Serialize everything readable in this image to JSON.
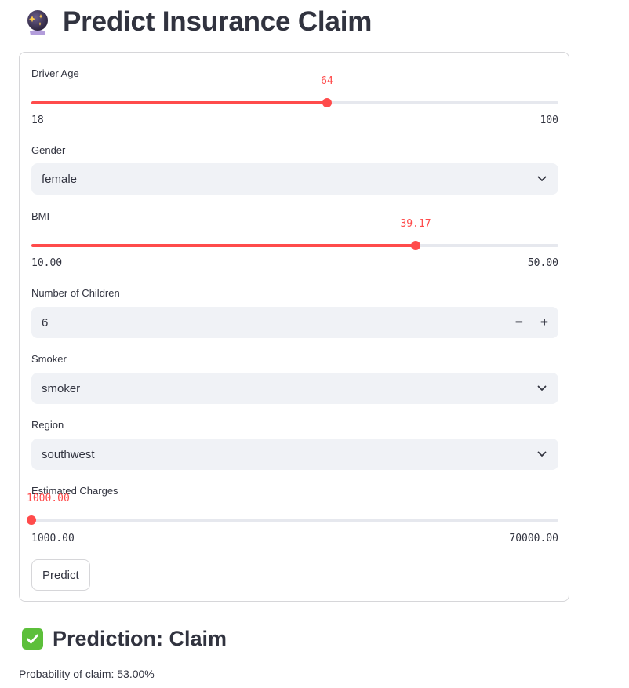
{
  "header": {
    "icon": "crystal-ball-icon",
    "title": "Predict Insurance Claim"
  },
  "form": {
    "driver_age": {
      "label": "Driver Age",
      "value": "64",
      "value_num": 64,
      "min": "18",
      "max": "100",
      "min_num": 18,
      "max_num": 100
    },
    "gender": {
      "label": "Gender",
      "value": "female"
    },
    "bmi": {
      "label": "BMI",
      "value": "39.17",
      "value_num": 39.17,
      "min": "10.00",
      "max": "50.00",
      "min_num": 10,
      "max_num": 50
    },
    "children": {
      "label": "Number of Children",
      "value": "6",
      "minus": "−",
      "plus": "+"
    },
    "smoker": {
      "label": "Smoker",
      "value": "smoker"
    },
    "region": {
      "label": "Region",
      "value": "southwest"
    },
    "charges": {
      "label": "Estimated Charges",
      "value": "1000.00",
      "value_num": 1000,
      "min": "1000.00",
      "max": "70000.00",
      "min_num": 1000,
      "max_num": 70000
    },
    "predict_label": "Predict"
  },
  "result": {
    "icon": "check-mark-icon",
    "heading": "Prediction: Claim",
    "probability_text": "Probability of claim: 53.00%"
  },
  "colors": {
    "accent": "#ff4b4b",
    "track": "#e6e8ee",
    "field_bg": "#f0f2f6",
    "success": "#5cbf3a"
  }
}
